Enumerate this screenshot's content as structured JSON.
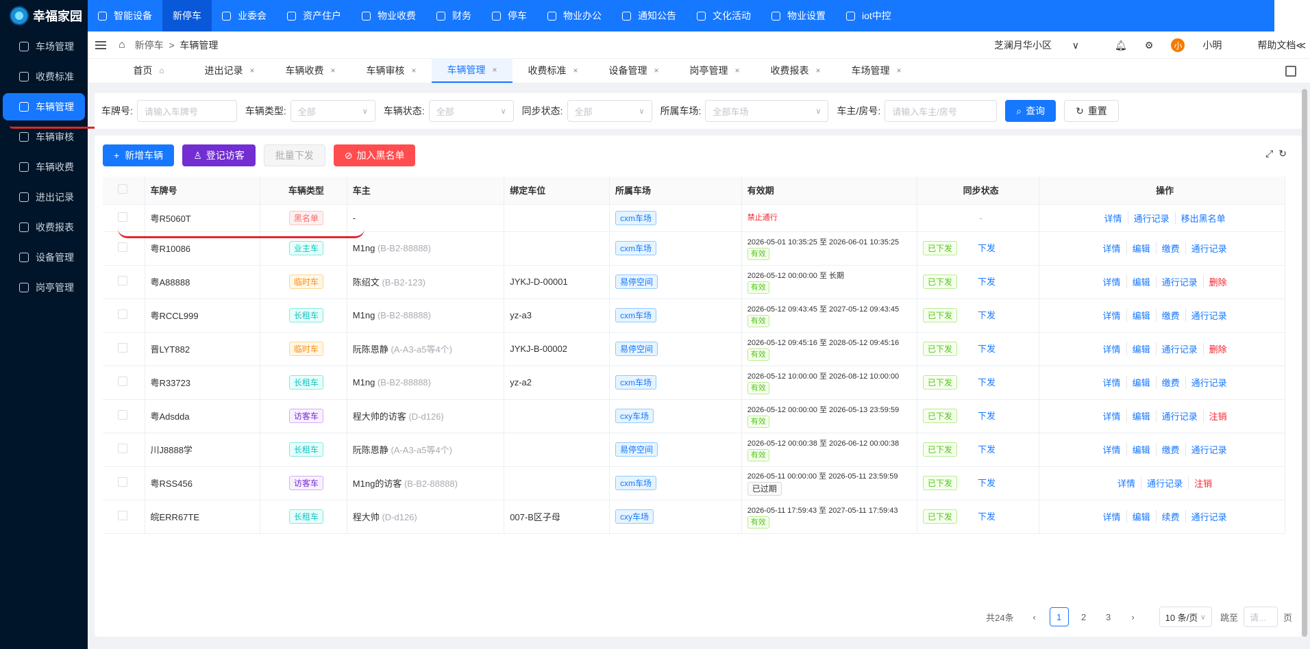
{
  "app": {
    "logo": "幸福家园"
  },
  "sidebar": {
    "items": [
      {
        "label": "车场管理"
      },
      {
        "label": "收费标准"
      },
      {
        "label": "车辆管理",
        "active": true
      },
      {
        "label": "车辆审核"
      },
      {
        "label": "车辆收费"
      },
      {
        "label": "进出记录"
      },
      {
        "label": "收费报表"
      },
      {
        "label": "设备管理"
      },
      {
        "label": "岗亭管理"
      }
    ]
  },
  "topnav": {
    "items": [
      {
        "label": "智能设备"
      },
      {
        "label": "新停车",
        "active": true
      },
      {
        "label": "业委会"
      },
      {
        "label": "资产住户"
      },
      {
        "label": "物业收费"
      },
      {
        "label": "财务"
      },
      {
        "label": "停车"
      },
      {
        "label": "物业办公"
      },
      {
        "label": "通知公告"
      },
      {
        "label": "文化活动"
      },
      {
        "label": "物业设置"
      },
      {
        "label": "iot中控"
      }
    ]
  },
  "breadcrumb": {
    "parent": "新停车",
    "sep": ">",
    "current": "车辆管理"
  },
  "header": {
    "community": "芝澜月华小区",
    "chevron": "∨",
    "avatar_char": "小",
    "user": "小明",
    "help": "帮助文档≪"
  },
  "tabs": [
    {
      "label": "首页",
      "icon": "home-icon"
    },
    {
      "label": "进出记录"
    },
    {
      "label": "车辆收费"
    },
    {
      "label": "车辆审核"
    },
    {
      "label": "车辆管理",
      "active": true
    },
    {
      "label": "收费标准"
    },
    {
      "label": "设备管理"
    },
    {
      "label": "岗亭管理"
    },
    {
      "label": "收费报表"
    },
    {
      "label": "车场管理"
    }
  ],
  "filter": {
    "plate_label": "车牌号:",
    "plate_placeholder": "请输入车牌号",
    "type_label": "车辆类型:",
    "type_value": "全部",
    "status_label": "车辆状态:",
    "status_value": "全部",
    "sync_label": "同步状态:",
    "sync_value": "全部",
    "park_label": "所属车场:",
    "park_value": "全部车场",
    "owner_label": "车主/房号:",
    "owner_placeholder": "请输入车主/房号",
    "search": "查询",
    "reset": "重置"
  },
  "actions": {
    "add": "新增车辆",
    "visitor": "登记访客",
    "batch": "批量下发",
    "blacklist": "加入黑名单"
  },
  "table": {
    "headers": [
      "车牌号",
      "车辆类型",
      "车主",
      "绑定车位",
      "所属车场",
      "有效期",
      "同步状态",
      "操作"
    ],
    "rows": [
      {
        "plate": "粤R5060T",
        "type": "黑名单",
        "tcls": "t-red",
        "owner": "-",
        "owner_sub": "",
        "space": "",
        "park": "cxm车场",
        "period": "禁止通行",
        "status": "",
        "sync": "",
        "push": "",
        "ops": [
          "详情",
          "通行记录",
          "移出黑名单"
        ],
        "blk": true
      },
      {
        "plate": "粤R10086",
        "type": "业主车",
        "tcls": "t-green",
        "owner": "M1ng",
        "owner_sub": "(B-B2-88888)",
        "space": "",
        "park": "cxm车场",
        "period": "2026-05-01 10:35:25 至 2026-06-01 10:35:25",
        "status": "有效",
        "sync": "已下发",
        "push": "下发",
        "ops": [
          "详情",
          "编辑",
          "缴费",
          "通行记录"
        ]
      },
      {
        "plate": "粤A88888",
        "type": "临时车",
        "tcls": "t-orange",
        "owner": "陈绍文",
        "owner_sub": "(B-B2-123)",
        "space": "JYKJ-D-00001",
        "park": "易停空间",
        "period": "2026-05-12 00:00:00 至 长期",
        "status": "有效",
        "sync": "已下发",
        "push": "下发",
        "ops": [
          "详情",
          "编辑",
          "通行记录",
          "删除"
        ]
      },
      {
        "plate": "粤RCCL999",
        "type": "长租车",
        "tcls": "t-green",
        "owner": "M1ng",
        "owner_sub": "(B-B2-88888)",
        "space": "yz-a3",
        "park": "cxm车场",
        "period": "2026-05-12 09:43:45 至 2027-05-12 09:43:45",
        "status": "有效",
        "sync": "已下发",
        "push": "下发",
        "ops": [
          "详情",
          "编辑",
          "缴费",
          "通行记录"
        ]
      },
      {
        "plate": "晋LYT882",
        "type": "临时车",
        "tcls": "t-orange",
        "owner": "阮陈恩静",
        "owner_sub": "(A-A3-a5等4个)",
        "space": "JYKJ-B-00002",
        "park": "易停空间",
        "period": "2026-05-12 09:45:16 至 2028-05-12 09:45:16",
        "status": "有效",
        "sync": "已下发",
        "push": "下发",
        "ops": [
          "详情",
          "编辑",
          "通行记录",
          "删除"
        ]
      },
      {
        "plate": "粤R33723",
        "type": "长租车",
        "tcls": "t-green",
        "owner": "M1ng",
        "owner_sub": "(B-B2-88888)",
        "space": "yz-a2",
        "park": "cxm车场",
        "period": "2026-05-12 10:00:00 至 2026-08-12 10:00:00",
        "status": "有效",
        "sync": "已下发",
        "push": "下发",
        "ops": [
          "详情",
          "编辑",
          "缴费",
          "通行记录"
        ]
      },
      {
        "plate": "粤Adsdda",
        "type": "访客车",
        "tcls": "t-purple",
        "owner": "程大帅的访客",
        "owner_sub": "(D-d126)",
        "space": "",
        "park": "cxy车场",
        "period": "2026-05-12 00:00:00 至 2026-05-13 23:59:59",
        "status": "有效",
        "sync": "已下发",
        "push": "下发",
        "ops": [
          "详情",
          "编辑",
          "通行记录",
          "注销"
        ]
      },
      {
        "plate": "川J8888学",
        "type": "长租车",
        "tcls": "t-green",
        "owner": "阮陈恩静",
        "owner_sub": "(A-A3-a5等4个)",
        "space": "",
        "park": "易停空间",
        "period": "2026-05-12 00:00:38 至 2026-06-12 00:00:38",
        "status": "有效",
        "sync": "已下发",
        "push": "下发",
        "ops": [
          "详情",
          "编辑",
          "缴费",
          "通行记录"
        ]
      },
      {
        "plate": "粤RSS456",
        "type": "访客车",
        "tcls": "t-purple",
        "owner": "M1ng的访客",
        "owner_sub": "(B-B2-88888)",
        "space": "",
        "park": "cxm车场",
        "period": "2026-05-11 00:00:00 至 2026-05-11 23:59:59",
        "status": "已过期",
        "sync": "已下发",
        "push": "下发",
        "ops": [
          "详情",
          "通行记录",
          "注销"
        ]
      },
      {
        "plate": "皖ERR67TE",
        "type": "长租车",
        "tcls": "t-green",
        "owner": "程大帅",
        "owner_sub": "(D-d126)",
        "space": "007-B区子母",
        "park": "cxy车场",
        "period": "2026-05-11 17:59:43 至 2027-05-11 17:59:43",
        "status": "有效",
        "sync": "已下发",
        "push": "下发",
        "ops": [
          "详情",
          "编辑",
          "续费",
          "通行记录"
        ]
      }
    ],
    "placeholder_dash": "-"
  },
  "pagination": {
    "total": "共24条",
    "pages": [
      "1",
      "2",
      "3"
    ],
    "size": "10 条/页",
    "jump": "跳至",
    "jump_placeholder": "请...",
    "page_unit": "页"
  }
}
